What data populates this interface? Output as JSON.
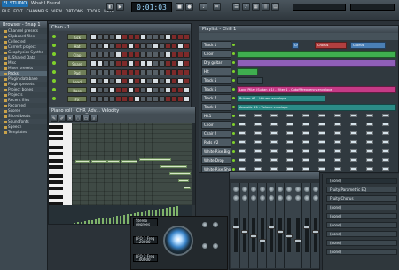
{
  "app": {
    "logo": "FL STUDIO",
    "title": "What I Found",
    "time": "0:01:03"
  },
  "menu": [
    "FILE",
    "EDIT",
    "CHANNELS",
    "VIEW",
    "OPTIONS",
    "TOOLS",
    "HELP"
  ],
  "browser": {
    "title": "Browser - Snap 1",
    "items": [
      "Channel presets",
      "Clipboard files",
      "Collected",
      "Current project",
      "Geophysics Synths",
      "IL Shared Data",
      "Misc",
      "Mixer presets",
      "Packs",
      "Plugin database",
      "Plugin presets",
      "Project bones",
      "Projects",
      "Recent files",
      "Recorded",
      "Scores",
      "Sliced beats",
      "Soundfonts",
      "Speech",
      "Templates"
    ]
  },
  "stepseq": {
    "title": "Chan - 1",
    "channels": [
      "Kick",
      "Hat",
      "Clap",
      "Snare",
      "Pad",
      "Lead",
      "Bass",
      "FX"
    ]
  },
  "pianoroll": {
    "title": "Piano roll - CHR_Adv... Velocity"
  },
  "playlist": {
    "title": "Playlist - Chill 1",
    "tracks": [
      {
        "label": "Track 1",
        "clips": [
          {
            "text": "Chorus"
          },
          {
            "text": "Chorus"
          },
          {
            "text": "Chorus"
          }
        ]
      },
      {
        "label": "Choir",
        "clips": [
          {
            "text": ""
          }
        ]
      },
      {
        "label": "Dry guitar",
        "clips": [
          {
            "text": ""
          }
        ]
      },
      {
        "label": "Hit",
        "clips": [
          {
            "text": ""
          }
        ]
      },
      {
        "label": "Track 5",
        "clips": [
          {
            "text": ""
          }
        ]
      },
      {
        "label": "Track 6",
        "clips": [
          {
            "text": "Love Pillar (Sultan #1) - Filter 1 - Cutoff frequency envelope"
          }
        ]
      },
      {
        "label": "Track 7",
        "clips": [
          {
            "text": "Rubber #1 - Volume envelope"
          }
        ]
      },
      {
        "label": "Track 8",
        "clips": [
          {
            "text": "Acoustic #1 - Volume envelope"
          }
        ]
      },
      {
        "label": "Hit1",
        "clips": []
      },
      {
        "label": "Choir",
        "clips": []
      },
      {
        "label": "Chair 2",
        "clips": []
      },
      {
        "label": "Pads #2",
        "clips": []
      },
      {
        "label": "White.Rise.Big",
        "clips": []
      },
      {
        "label": "White.Drop",
        "clips": []
      },
      {
        "label": "White.Rise.Short",
        "clips": []
      }
    ]
  },
  "fx": {
    "header": "(none)",
    "slots": [
      "Fruity Parametric EQ",
      "Fruity Chorus",
      "(none)",
      "(none)",
      "(none)",
      "(none)",
      "(none)",
      "(none)"
    ]
  },
  "plugin": {
    "lfo1": "LFO 1 Freq",
    "lfo1val": "1.20000",
    "lfo2": "LFO 2 Freq",
    "lfo2val": "1.00000",
    "stereo": "Stereo",
    "stereoval": "degrees"
  },
  "colors": {
    "accent": "#7fd12b",
    "clip_green": "#3fae4f",
    "clip_purple": "#8f5fb8",
    "clip_pink": "#c53a86",
    "clip_teal": "#2b8b86"
  }
}
